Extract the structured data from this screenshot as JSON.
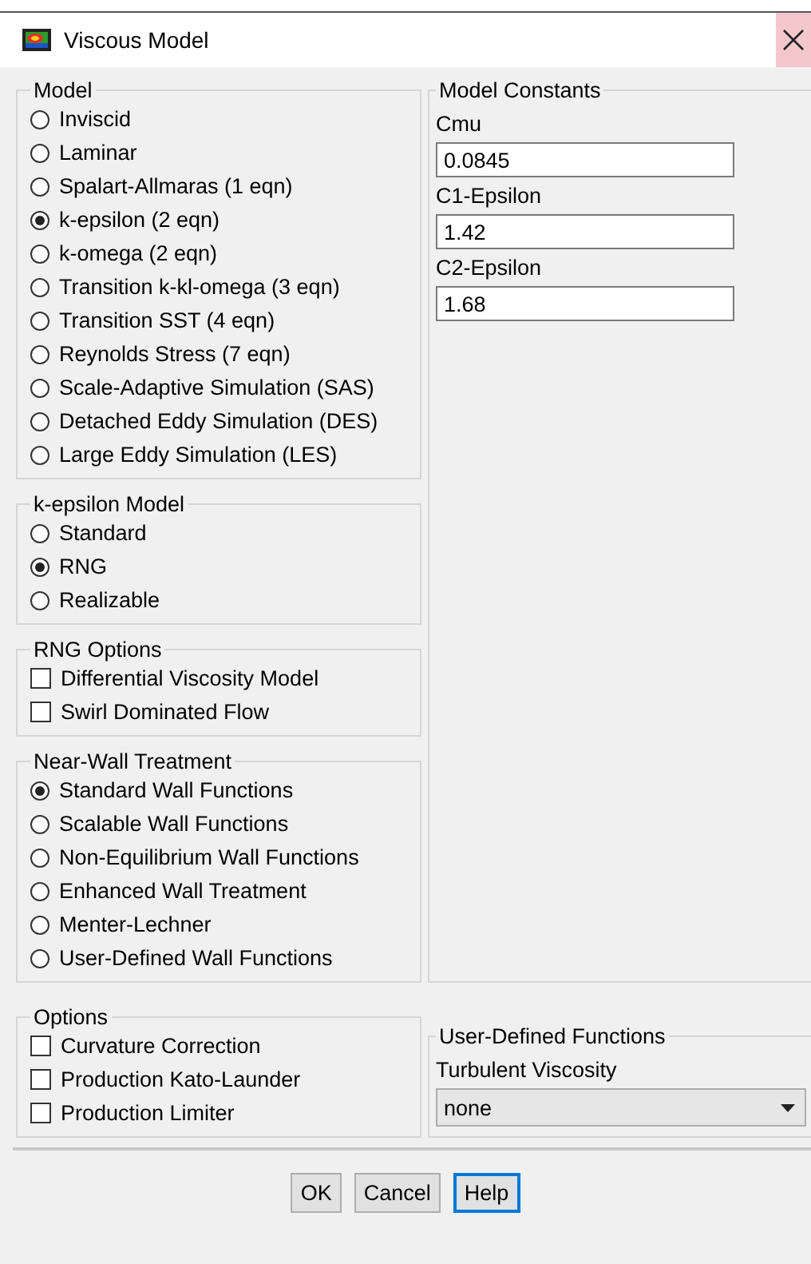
{
  "window": {
    "title": "Viscous Model"
  },
  "left_groups": [
    {
      "title": "Model",
      "kind": "radio",
      "items": [
        {
          "label": "Inviscid",
          "selected": false
        },
        {
          "label": "Laminar",
          "selected": false
        },
        {
          "label": "Spalart-Allmaras (1 eqn)",
          "selected": false
        },
        {
          "label": "k-epsilon (2 eqn)",
          "selected": true
        },
        {
          "label": "k-omega (2 eqn)",
          "selected": false
        },
        {
          "label": "Transition k-kl-omega (3 eqn)",
          "selected": false
        },
        {
          "label": "Transition SST (4 eqn)",
          "selected": false
        },
        {
          "label": "Reynolds Stress (7 eqn)",
          "selected": false
        },
        {
          "label": "Scale-Adaptive Simulation (SAS)",
          "selected": false
        },
        {
          "label": "Detached Eddy Simulation (DES)",
          "selected": false
        },
        {
          "label": "Large Eddy Simulation (LES)",
          "selected": false
        }
      ]
    },
    {
      "title": "k-epsilon Model",
      "kind": "radio",
      "items": [
        {
          "label": "Standard",
          "selected": false
        },
        {
          "label": "RNG",
          "selected": true
        },
        {
          "label": "Realizable",
          "selected": false
        }
      ]
    },
    {
      "title": "RNG Options",
      "kind": "checkbox",
      "items": [
        {
          "label": "Differential Viscosity Model",
          "checked": false
        },
        {
          "label": "Swirl Dominated Flow",
          "checked": false
        }
      ]
    },
    {
      "title": "Near-Wall Treatment",
      "kind": "radio",
      "items": [
        {
          "label": "Standard Wall Functions",
          "selected": true
        },
        {
          "label": "Scalable Wall Functions",
          "selected": false
        },
        {
          "label": "Non-Equilibrium Wall Functions",
          "selected": false
        },
        {
          "label": "Enhanced Wall Treatment",
          "selected": false
        },
        {
          "label": "Menter-Lechner",
          "selected": false
        },
        {
          "label": "User-Defined Wall Functions",
          "selected": false
        }
      ]
    }
  ],
  "model_constants": {
    "title": "Model Constants",
    "fields": [
      {
        "label": "Cmu",
        "value": "0.0845"
      },
      {
        "label": "C1-Epsilon",
        "value": "1.42"
      },
      {
        "label": "C2-Epsilon",
        "value": "1.68"
      }
    ]
  },
  "options": {
    "title": "Options",
    "kind": "checkbox",
    "items": [
      {
        "label": "Curvature Correction",
        "checked": false
      },
      {
        "label": "Production Kato-Launder",
        "checked": false
      },
      {
        "label": "Production Limiter",
        "checked": false
      }
    ]
  },
  "udf": {
    "title": "User-Defined Functions",
    "label": "Turbulent Viscosity",
    "value": "none"
  },
  "buttons": [
    {
      "label": "OK",
      "focused": false
    },
    {
      "label": "Cancel",
      "focused": false
    },
    {
      "label": "Help",
      "focused": true
    }
  ]
}
